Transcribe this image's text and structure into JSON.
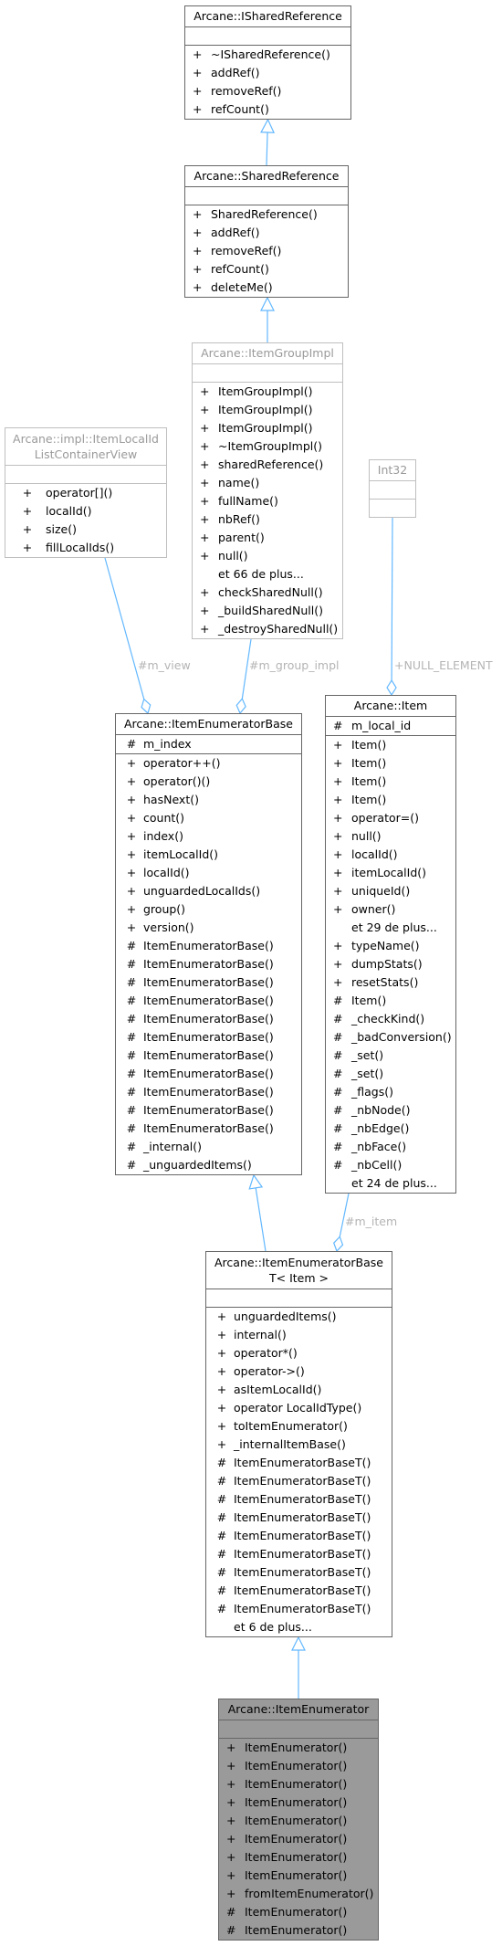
{
  "diagram": {
    "colors": {
      "edge": "#63b8ff",
      "box_border": "#666666",
      "focus_fill": "#9a9a9a",
      "label": "#b4b4b4"
    },
    "classes": {
      "ishared": {
        "title": "Arcane::ISharedReference",
        "members": [
          {
            "v": "+",
            "n": "~ISharedReference()"
          },
          {
            "v": "+",
            "n": "addRef()"
          },
          {
            "v": "+",
            "n": "removeRef()"
          },
          {
            "v": "+",
            "n": "refCount()"
          }
        ]
      },
      "sharedref": {
        "title": "Arcane::SharedReference",
        "members": [
          {
            "v": "+",
            "n": "SharedReference()"
          },
          {
            "v": "+",
            "n": "addRef()"
          },
          {
            "v": "+",
            "n": "removeRef()"
          },
          {
            "v": "+",
            "n": "refCount()"
          },
          {
            "v": "+",
            "n": "deleteMe()"
          }
        ]
      },
      "itemgroupimpl": {
        "title": "Arcane::ItemGroupImpl",
        "members": [
          {
            "v": "+",
            "n": "ItemGroupImpl()"
          },
          {
            "v": "+",
            "n": "ItemGroupImpl()"
          },
          {
            "v": "+",
            "n": "ItemGroupImpl()"
          },
          {
            "v": "+",
            "n": "~ItemGroupImpl()"
          },
          {
            "v": "+",
            "n": "sharedReference()"
          },
          {
            "v": "+",
            "n": "name()"
          },
          {
            "v": "+",
            "n": "fullName()"
          },
          {
            "v": "+",
            "n": "nbRef()"
          },
          {
            "v": "+",
            "n": "parent()"
          },
          {
            "v": "+",
            "n": "null()"
          },
          {
            "v": "",
            "n": "et 66 de plus..."
          },
          {
            "v": "+",
            "n": "checkSharedNull()"
          },
          {
            "v": "+",
            "n": "_buildSharedNull()"
          },
          {
            "v": "+",
            "n": "_destroySharedNull()"
          }
        ]
      },
      "localid": {
        "title_line1": "Arcane::impl::ItemLocalId",
        "title_line2": "ListContainerView",
        "members": [
          {
            "v": "+",
            "n": "operator[]()"
          },
          {
            "v": "+",
            "n": "localId()"
          },
          {
            "v": "+",
            "n": "size()"
          },
          {
            "v": "+",
            "n": "fillLocalIds()"
          }
        ]
      },
      "int32": {
        "title": "Int32"
      },
      "item": {
        "title": "Arcane::Item",
        "attrs": [
          {
            "v": "#",
            "n": "m_local_id"
          }
        ],
        "members": [
          {
            "v": "+",
            "n": "Item()"
          },
          {
            "v": "+",
            "n": "Item()"
          },
          {
            "v": "+",
            "n": "Item()"
          },
          {
            "v": "+",
            "n": "Item()"
          },
          {
            "v": "+",
            "n": "operator=()"
          },
          {
            "v": "+",
            "n": "null()"
          },
          {
            "v": "+",
            "n": "localId()"
          },
          {
            "v": "+",
            "n": "itemLocalId()"
          },
          {
            "v": "+",
            "n": "uniqueId()"
          },
          {
            "v": "+",
            "n": "owner()"
          },
          {
            "v": "",
            "n": "et 29 de plus..."
          },
          {
            "v": "+",
            "n": "typeName()"
          },
          {
            "v": "+",
            "n": "dumpStats()"
          },
          {
            "v": "+",
            "n": "resetStats()"
          },
          {
            "v": "#",
            "n": "Item()"
          },
          {
            "v": "#",
            "n": "_checkKind()"
          },
          {
            "v": "#",
            "n": "_badConversion()"
          },
          {
            "v": "#",
            "n": "_set()"
          },
          {
            "v": "#",
            "n": "_set()"
          },
          {
            "v": "#",
            "n": "_flags()"
          },
          {
            "v": "#",
            "n": "_nbNode()"
          },
          {
            "v": "#",
            "n": "_nbEdge()"
          },
          {
            "v": "#",
            "n": "_nbFace()"
          },
          {
            "v": "#",
            "n": "_nbCell()"
          },
          {
            "v": "",
            "n": "et 24 de plus..."
          }
        ]
      },
      "enumbase": {
        "title": "Arcane::ItemEnumeratorBase",
        "attrs": [
          {
            "v": "#",
            "n": "m_index"
          }
        ],
        "members": [
          {
            "v": "+",
            "n": "operator++()"
          },
          {
            "v": "+",
            "n": "operator()()"
          },
          {
            "v": "+",
            "n": "hasNext()"
          },
          {
            "v": "+",
            "n": "count()"
          },
          {
            "v": "+",
            "n": "index()"
          },
          {
            "v": "+",
            "n": "itemLocalId()"
          },
          {
            "v": "+",
            "n": "localId()"
          },
          {
            "v": "+",
            "n": "unguardedLocalIds()"
          },
          {
            "v": "+",
            "n": "group()"
          },
          {
            "v": "+",
            "n": "version()"
          },
          {
            "v": "#",
            "n": "ItemEnumeratorBase()"
          },
          {
            "v": "#",
            "n": "ItemEnumeratorBase()"
          },
          {
            "v": "#",
            "n": "ItemEnumeratorBase()"
          },
          {
            "v": "#",
            "n": "ItemEnumeratorBase()"
          },
          {
            "v": "#",
            "n": "ItemEnumeratorBase()"
          },
          {
            "v": "#",
            "n": "ItemEnumeratorBase()"
          },
          {
            "v": "#",
            "n": "ItemEnumeratorBase()"
          },
          {
            "v": "#",
            "n": "ItemEnumeratorBase()"
          },
          {
            "v": "#",
            "n": "ItemEnumeratorBase()"
          },
          {
            "v": "#",
            "n": "ItemEnumeratorBase()"
          },
          {
            "v": "#",
            "n": "ItemEnumeratorBase()"
          },
          {
            "v": "#",
            "n": "_internal()"
          },
          {
            "v": "#",
            "n": "_unguardedItems()"
          }
        ]
      },
      "enumbaset": {
        "title_line1": "Arcane::ItemEnumeratorBase",
        "title_line2": "T< Item >",
        "members": [
          {
            "v": "+",
            "n": "unguardedItems()"
          },
          {
            "v": "+",
            "n": "internal()"
          },
          {
            "v": "+",
            "n": "operator*()"
          },
          {
            "v": "+",
            "n": "operator->()"
          },
          {
            "v": "+",
            "n": "asItemLocalId()"
          },
          {
            "v": "+",
            "n": "operator LocalIdType()"
          },
          {
            "v": "+",
            "n": "toItemEnumerator()"
          },
          {
            "v": "+",
            "n": "_internalItemBase()"
          },
          {
            "v": "#",
            "n": "ItemEnumeratorBaseT()"
          },
          {
            "v": "#",
            "n": "ItemEnumeratorBaseT()"
          },
          {
            "v": "#",
            "n": "ItemEnumeratorBaseT()"
          },
          {
            "v": "#",
            "n": "ItemEnumeratorBaseT()"
          },
          {
            "v": "#",
            "n": "ItemEnumeratorBaseT()"
          },
          {
            "v": "#",
            "n": "ItemEnumeratorBaseT()"
          },
          {
            "v": "#",
            "n": "ItemEnumeratorBaseT()"
          },
          {
            "v": "#",
            "n": "ItemEnumeratorBaseT()"
          },
          {
            "v": "#",
            "n": "ItemEnumeratorBaseT()"
          },
          {
            "v": "",
            "n": "et 6 de plus..."
          }
        ]
      },
      "itemenum": {
        "title": "Arcane::ItemEnumerator",
        "members": [
          {
            "v": "+",
            "n": "ItemEnumerator()"
          },
          {
            "v": "+",
            "n": "ItemEnumerator()"
          },
          {
            "v": "+",
            "n": "ItemEnumerator()"
          },
          {
            "v": "+",
            "n": "ItemEnumerator()"
          },
          {
            "v": "+",
            "n": "ItemEnumerator()"
          },
          {
            "v": "+",
            "n": "ItemEnumerator()"
          },
          {
            "v": "+",
            "n": "ItemEnumerator()"
          },
          {
            "v": "+",
            "n": "ItemEnumerator()"
          },
          {
            "v": "+",
            "n": "fromItemEnumerator()"
          },
          {
            "v": "#",
            "n": "ItemEnumerator()"
          },
          {
            "v": "#",
            "n": "ItemEnumerator()"
          }
        ]
      }
    },
    "edge_labels": {
      "m_view": "#m_view",
      "m_group_impl": "#m_group_impl",
      "null_element": "+NULL_ELEMENT",
      "m_item": "#m_item"
    }
  }
}
